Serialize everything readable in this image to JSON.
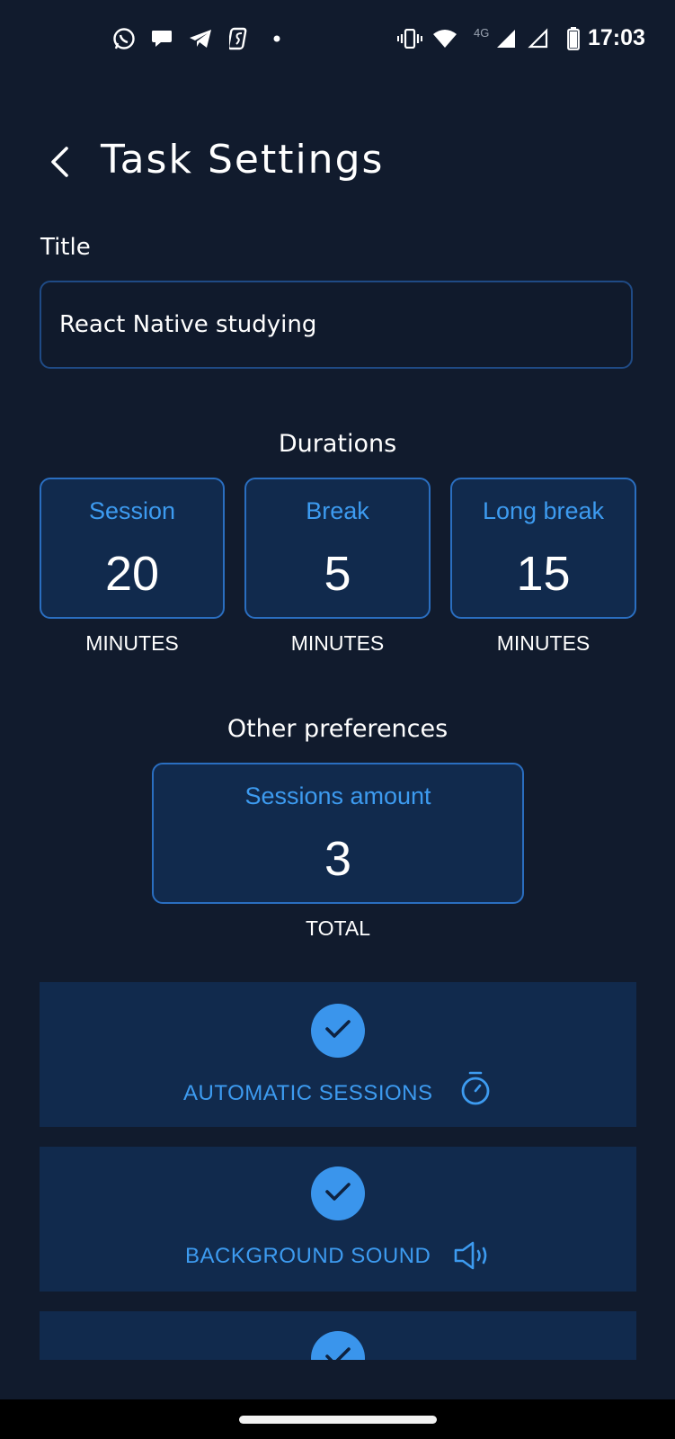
{
  "status_bar": {
    "time": "17:03",
    "network": "4G",
    "left_icons": [
      "whatsapp-icon",
      "chat-icon",
      "telegram-icon",
      "app-icon",
      "dot-icon"
    ],
    "right_icons": [
      "vibrate-icon",
      "wifi-icon",
      "signal-icon",
      "signal-empty-icon",
      "battery-icon"
    ]
  },
  "header": {
    "title": "Task Settings",
    "back_icon": "chevron-left-icon"
  },
  "form": {
    "title_label": "Title",
    "title_value": "React Native studying"
  },
  "durations": {
    "heading": "Durations",
    "items": [
      {
        "label": "Session",
        "value": "20",
        "unit": "MINUTES"
      },
      {
        "label": "Break",
        "value": "5",
        "unit": "MINUTES"
      },
      {
        "label": "Long break",
        "value": "15",
        "unit": "MINUTES"
      }
    ]
  },
  "preferences": {
    "heading": "Other preferences",
    "sessions": {
      "label": "Sessions amount",
      "value": "3",
      "unit": "TOTAL"
    }
  },
  "toggles": [
    {
      "label": "AUTOMATIC SESSIONS",
      "checked": true,
      "icon": "timer-icon"
    },
    {
      "label": "BACKGROUND SOUND",
      "checked": true,
      "icon": "speaker-icon"
    },
    {
      "label": "",
      "checked": true,
      "icon": ""
    }
  ],
  "colors": {
    "background": "#111b2d",
    "card": "#112a4d",
    "accent": "#3d9bf0",
    "check": "#3a95ec"
  }
}
